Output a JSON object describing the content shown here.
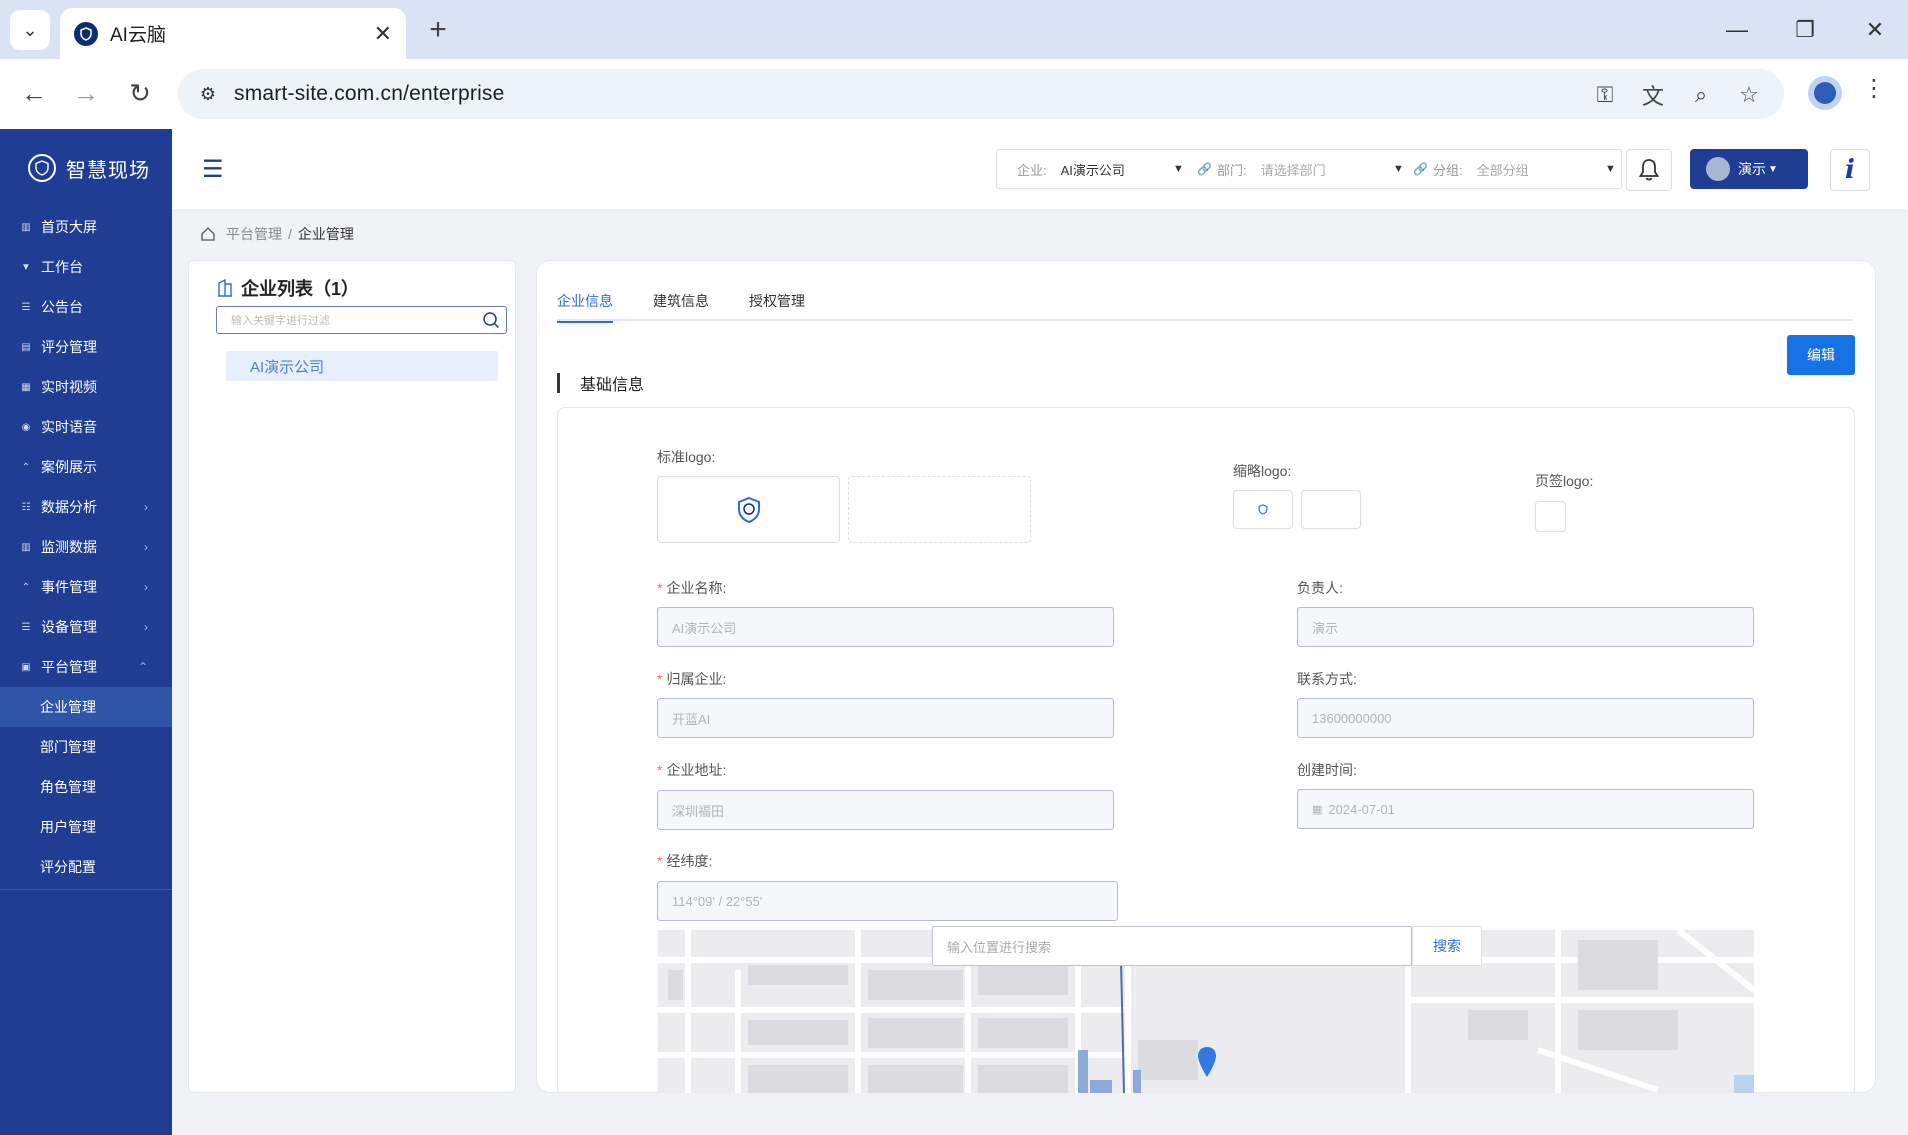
{
  "browser": {
    "tab_title": "AI云脑",
    "url": "smart-site.com.cn/enterprise"
  },
  "sidebar": {
    "brand": "智慧现场",
    "items": [
      {
        "label": "首页大屏",
        "icon": "dashboard-icon"
      },
      {
        "label": "工作台",
        "icon": "workbench-icon"
      },
      {
        "label": "公告台",
        "icon": "notice-icon"
      },
      {
        "label": "评分管理",
        "icon": "score-icon"
      },
      {
        "label": "实时视频",
        "icon": "video-icon"
      },
      {
        "label": "实时语音",
        "icon": "voice-icon"
      },
      {
        "label": "案例展示",
        "icon": "case-icon"
      },
      {
        "label": "数据分析",
        "icon": "analysis-icon"
      },
      {
        "label": "监测数据",
        "icon": "monitor-icon"
      },
      {
        "label": "事件管理",
        "icon": "event-icon"
      },
      {
        "label": "设备管理",
        "icon": "device-icon"
      },
      {
        "label": "平台管理",
        "icon": "platform-icon"
      }
    ],
    "sub_items": [
      "企业管理",
      "部门管理",
      "角色管理",
      "用户管理",
      "评分配置"
    ],
    "active_sub": "企业管理",
    "colors": {
      "background": "#1e3d93",
      "active": "#2f54a8"
    }
  },
  "header": {
    "enterprise_label": "企业:",
    "enterprise_value": "AI演示公司",
    "department_label": "部门:",
    "department_placeholder": "请选择部门",
    "group_label": "分组:",
    "group_placeholder": "全部分组",
    "user_label": "演示",
    "info_label": "i"
  },
  "breadcrumb": {
    "parent": "平台管理",
    "separator": "/",
    "current": "企业管理"
  },
  "enterprise_list": {
    "title": "企业列表（1）",
    "search_placeholder": "输入关键字进行过滤",
    "items": [
      "AI演示公司"
    ]
  },
  "detail": {
    "tabs": [
      "企业信息",
      "建筑信息",
      "授权管理"
    ],
    "active_tab": "企业信息",
    "edit_button": "编辑",
    "section_title": "基础信息",
    "logos": {
      "standard_label": "标准logo:",
      "thumbnail_label": "缩略logo:",
      "tab_label": "页签logo:"
    },
    "fields": {
      "name": {
        "label": "企业名称:",
        "value": "AI演示公司",
        "required": true
      },
      "owner": {
        "label": "负责人:",
        "value": "演示",
        "required": false
      },
      "parent": {
        "label": "归属企业:",
        "value": "开蓝AI",
        "required": true
      },
      "contact": {
        "label": "联系方式:",
        "value": "13600000000",
        "required": false
      },
      "address": {
        "label": "企业地址:",
        "value": "深圳福田",
        "required": true
      },
      "created": {
        "label": "创建时间:",
        "value": "2024-07-01",
        "required": false
      },
      "coords": {
        "label": "经纬度:",
        "value": "114°09' / 22°55'",
        "required": true
      }
    },
    "map": {
      "search_placeholder": "输入位置进行搜索",
      "search_button": "搜索"
    },
    "accent_color": "#1673e6"
  }
}
